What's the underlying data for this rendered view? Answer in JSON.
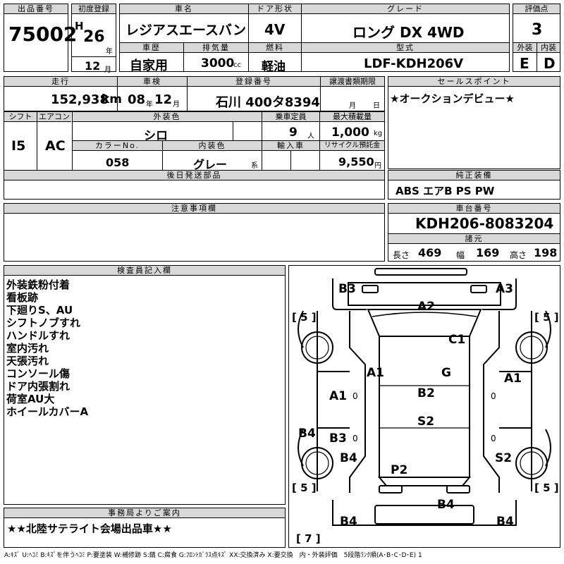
{
  "header": {
    "lot_label": "出品番号",
    "lot_value": "75002",
    "first_reg_label": "初度登録",
    "era": "H",
    "year": "26",
    "year_unit": "年",
    "month": "12",
    "month_unit": "月",
    "car_name_label": "車名",
    "car_name": "レジアスエースバン",
    "door_label": "ドア形状",
    "door": "4V",
    "grade_label": "グレード",
    "grade": "ロング DX 4WD",
    "score_label": "評価点",
    "score": "3",
    "history_label": "車歴",
    "history": "自家用",
    "disp_label": "排気量",
    "disp": "3000",
    "disp_unit": "cc",
    "fuel_label": "燃料",
    "fuel": "軽油",
    "model_label": "型式",
    "model": "LDF-KDH206V",
    "ext_label": "外装",
    "ext": "E",
    "int_label": "内装",
    "int": "D"
  },
  "spec": {
    "mileage_label": "走行",
    "mileage": "152,938",
    "mileage_unit": "km",
    "inspection_label": "車検",
    "insp_year": "08",
    "insp_year_unit": "年",
    "insp_month": "12",
    "insp_month_unit": "月",
    "reg_label": "登録番号",
    "reg": "石川 400タ8394",
    "transfer_label": "譲渡書類期限",
    "transfer_m": "月",
    "transfer_d": "日",
    "shift_label": "シフト",
    "shift": "I5",
    "ac_label": "エアコン",
    "ac": "AC",
    "color_label": "外装色",
    "color": "シロ",
    "cap_label": "乗車定員",
    "cap": "9",
    "cap_unit": "人",
    "load_label": "最大積載量",
    "load": "1,000",
    "load_unit": "kg",
    "colorno_label": "カラーNo.",
    "colorno": "058",
    "intcolor_label": "内装色",
    "intcolor": "グレー",
    "intcolor_unit": "系",
    "import_label": "輸入車",
    "recycle_label": "リサイクル預託金",
    "recycle": "9,550",
    "recycle_unit": "円"
  },
  "sales_point": {
    "label": "セールスポイント",
    "text": "★オークションデビュー★"
  },
  "later_parts": {
    "label": "後日発送部品"
  },
  "equipment": {
    "label": "純正装備",
    "text": "ABS エアB PS PW"
  },
  "caution": {
    "label": "注意事項欄"
  },
  "chassis": {
    "label": "車台番号",
    "value": "KDH206-8083204"
  },
  "dims": {
    "label": "諸元",
    "length_label": "長さ",
    "length": "469",
    "width_label": "幅",
    "width": "169",
    "height_label": "高さ",
    "height": "198"
  },
  "inspector": {
    "label": "検査員記入欄",
    "notes": [
      "外装鉄粉付着",
      "看板跡",
      "下廻りS、AU",
      "シフトノブすれ",
      "ハンドルすれ",
      "室内汚れ",
      "天張汚れ",
      "コンソール傷",
      "ドア内張割れ",
      "荷室AU大",
      "ホイールカバーA"
    ]
  },
  "office": {
    "label": "事務局よりご案内",
    "text": "★★北陸サテライト会場出品車★★"
  },
  "diagram": {
    "marks": [
      "B3",
      "A3",
      "A2",
      "C1",
      "A1",
      "G",
      "A1",
      "A1",
      "B2",
      "B4",
      "B3",
      "S2",
      "B4",
      "S2",
      "P2",
      "B4",
      "B4",
      "B4"
    ],
    "tires": [
      "[ 5 ]",
      "[ 5 ]",
      "[ 5 ]",
      "[ 5 ]",
      "[ 7 ]"
    ],
    "door_marks": [
      "0",
      "0",
      "0",
      "0"
    ]
  },
  "legend": "A:ｷｽﾞ U:ﾍｺﾐ B:ｷｽﾞを伴うﾍｺﾐ P:要塗装 W:補修跡 S:錆 C:腐食 G:ﾌﾛﾝﾄｶﾞﾗｽ点ｷｽﾞ XX:交換済み X:要交換　内・外装評価　5段階ﾗﾝｸ順(A･B･C･D･E) 1"
}
